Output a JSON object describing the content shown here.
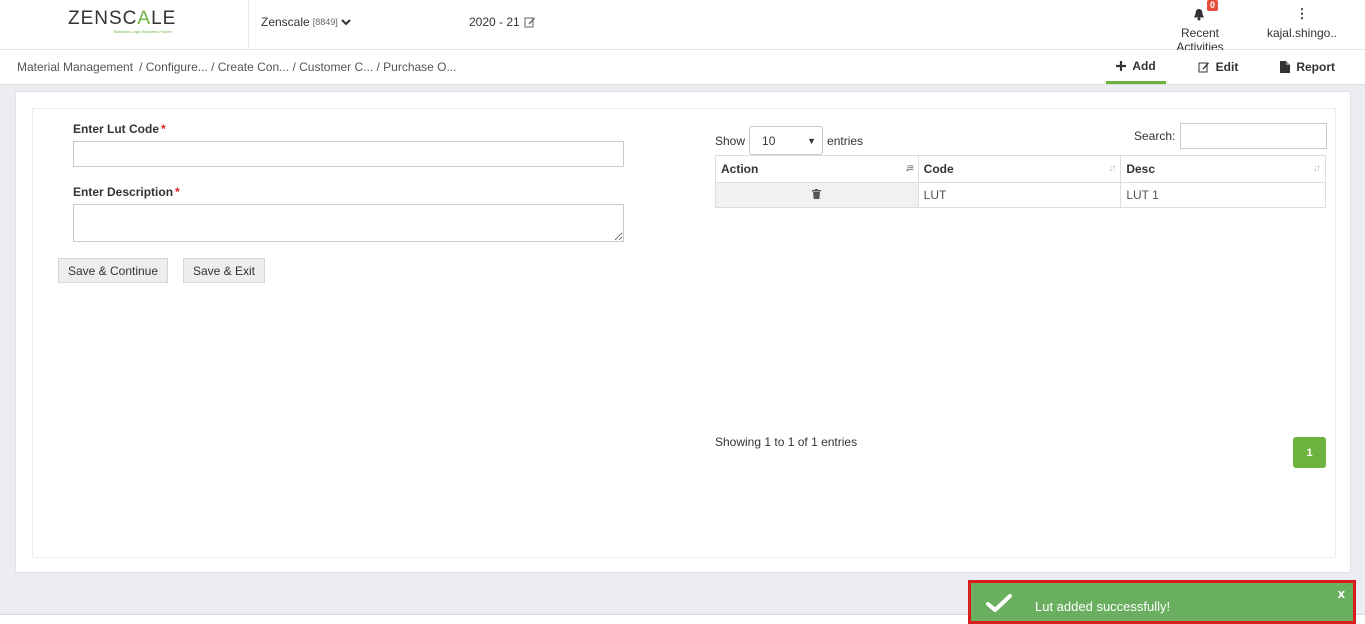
{
  "header": {
    "logo_main": "ZENSC",
    "logo_accent": "A",
    "logo_end": "LE",
    "logo_tagline": "Business Logic Business Forces",
    "company_name": "Zenscale",
    "company_code": "[8849]",
    "fiscal_year": "2020 - 21",
    "notifications_count": "0",
    "recent_activities_label": "Recent Activities",
    "user_name": "kajal.shingo.."
  },
  "breadcrumb": {
    "root": "Material Management",
    "path": "/ Configure... / Create Con... / Customer C... / Purchase O..."
  },
  "actions": {
    "add": "Add",
    "edit": "Edit",
    "report": "Report"
  },
  "form": {
    "lut_code_label": "Enter Lut Code",
    "lut_code_value": "",
    "description_label": "Enter Description",
    "description_value": "",
    "required_marker": "*",
    "save_continue": "Save & Continue",
    "save_exit": "Save & Exit"
  },
  "table": {
    "show_label": "Show",
    "page_length": "10",
    "entries_label": "entries",
    "search_label": "Search:",
    "search_value": "",
    "columns": [
      "Action",
      "Code",
      "Desc"
    ],
    "rows": [
      {
        "code": "LUT",
        "desc": "LUT 1"
      }
    ],
    "info": "Showing 1 to 1 of 1 entries",
    "current_page": "1"
  },
  "toast": {
    "message": "Lut added successfully!",
    "close": "x"
  },
  "colors": {
    "accent": "#6cb33f",
    "toast_bg": "#69af5f",
    "toast_border": "#d81d1d",
    "badge": "#e74c3c"
  }
}
